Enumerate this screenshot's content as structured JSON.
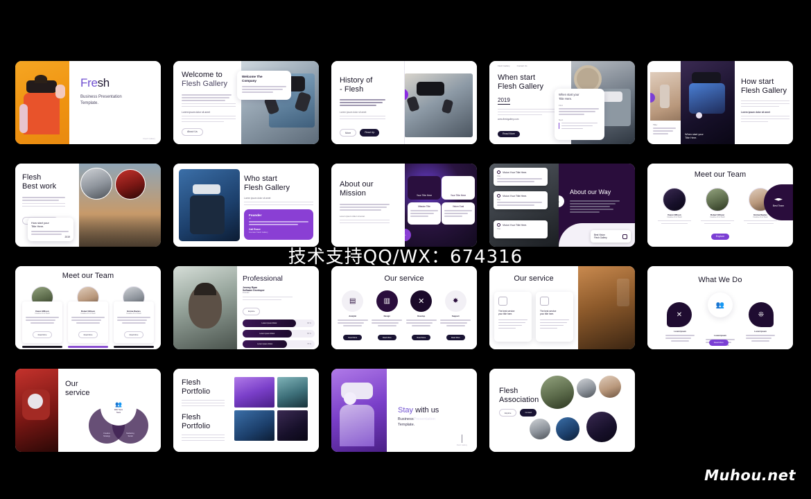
{
  "page": {
    "background": "#000000",
    "accent_purple": "#7b3fd4",
    "accent_deep": "#2a0d3c",
    "slide_bg": "#ffffff"
  },
  "watermarks": {
    "center": "技术支持QQ/WX：674316",
    "corner": "Muhou.net"
  },
  "slides": [
    {
      "id": "cover",
      "title": "Fresh",
      "title_part_1": "Fre",
      "title_part_2": "sh",
      "subtitle_line_1": "Business Presentation",
      "subtitle_line_2": "Template.",
      "image": "woman-orange-vr-headset",
      "footnote": "Flesh Gallery"
    },
    {
      "id": "welcome",
      "title_line_1": "Welcome to",
      "title_line_2": "Flesh Gallery",
      "card_title_line_1": "Welcome The",
      "card_title_line_2": "Company",
      "body": "Lorem ipsum dolor sit amet consectetur. Blandit vitae justo dolor sit amet nulla fringilla.",
      "section_label": "Lorem ipsum dolor sit amet",
      "button": "About Us",
      "image": "woman-vr-controllers"
    },
    {
      "id": "history",
      "title_line_1": "History of",
      "title_line_2": "- Flesh",
      "body": "Lorem ipsum dolor sit amet consectetur adipiscing elit sed do eiusmod tempor incididunt.",
      "section_label": "Lorem ipsum dolor sit amet",
      "button_secondary": "More",
      "button_primary": "Read Up",
      "image": "man-denim-vr-controllers"
    },
    {
      "id": "when-start",
      "nav_left": "Flesh Gallery",
      "nav_right": "Contact Us",
      "title_line_1": "When start",
      "title_line_2": "Flesh Gallery",
      "year": "2019",
      "link": "www.fleshgallery.com",
      "button": "Read More",
      "card_title_line_1": "When start your",
      "card_title_line_2": "Title Here.",
      "card_sub_1": "First",
      "card_sub_2": "Next",
      "image": "boy-vr-headset-clock"
    },
    {
      "id": "how-start",
      "title_line_1": "How start",
      "title_line_2": "Flesh Gallery",
      "section_label": "Lorem ipsum dolor sit amet",
      "overlay_line_1": "When start your",
      "overlay_line_2": "Title Here.",
      "caption_label": "Title :",
      "caption_body": "Lorem ipsum dolor sit amet consectetur adipiscing.",
      "image_left": "vr-room-pink",
      "image_right": "man-vr-blue-light"
    },
    {
      "id": "best-work",
      "title_line_1": "Flesh",
      "title_line_2": "Best work",
      "body": "Lorem ipsum dolor sit amet consectetur blandit.",
      "chip": "The best product you Will",
      "card_title_line_1": "How start your",
      "card_title_line_2": "Title Here.",
      "card_value": "2019",
      "image": "city-skyline-sunset"
    },
    {
      "id": "who-start",
      "title_line_1": "Who start",
      "title_line_2": "Flesh Gallery",
      "section_label": "Lorem ipsum dolor sit amet",
      "card_heading": "Founder",
      "card_sub": "of",
      "card_body": "Lorem ipsum dolor sit amet consectetur adipiscing elit blandit.",
      "card_name": "Call Roser",
      "card_role": "Founder Flesh Gallery",
      "image": "boy-vr-headset-screen"
    },
    {
      "id": "about-mission",
      "title_line_1": "About our",
      "title_line_2": "Mission",
      "body": "Lorem ipsum dolor sit amet consectetur adipiscing elit sed do eiusmod tempor.",
      "section_label": "Lorem ipsum dolor sit amet",
      "card_1_title": "Your Title Here",
      "card_2_title": "Your Title Here",
      "card_3_title": "Mission Title",
      "card_4_title": "Vision Goal",
      "image": "abstract-neon-keyboard"
    },
    {
      "id": "about-our-way",
      "title": "About our Way",
      "list_item_1": "Vision Your Title Here.",
      "list_item_2": "Vision Your Title Here.",
      "list_item_3": "Vision Your Title Here.",
      "list_sub": "Title :",
      "badge_line_1": "Best Vision",
      "badge_line_2": "Flesh Gallery",
      "image": "city-buildings-dark"
    },
    {
      "id": "meet-team-1",
      "title": "Meet our Team",
      "members": [
        {
          "name": "Karen Wilson",
          "role": "Creative Art of Flesh"
        },
        {
          "name": "Robert Ellison",
          "role": "Creative Art of Flesh"
        },
        {
          "name": "Emma Davies",
          "role": "Creative Art of Flesh"
        }
      ],
      "button": "Explore",
      "badge": "Best Team"
    },
    {
      "id": "meet-team-2",
      "title": "Meet our Team",
      "members": [
        {
          "name": "Karen Wilson",
          "role": "Creative Art of Flesh",
          "button": "Read More"
        },
        {
          "name": "Robert Ellison",
          "role": "Creative Art of Flesh",
          "button": "Read More"
        },
        {
          "name": "Emma Davies",
          "role": "Creative Art of Flesh",
          "button": "Read More"
        }
      ]
    },
    {
      "id": "professional",
      "title": "Professional",
      "name": "Jeremy Ryan",
      "role": "Software Developer",
      "meta": "Founder",
      "button": "Explore",
      "rows": [
        {
          "label": "Lorem Ipsum Dolor",
          "value": "90 %"
        },
        {
          "label": "Lorem Ipsum Dolor",
          "value": "80 %"
        },
        {
          "label": "Lorem Ipsum Dolor",
          "value": "75 %"
        }
      ],
      "image": "man-face-scan"
    },
    {
      "id": "our-service-icons",
      "title": "Our service",
      "items": [
        {
          "label": "Analytic",
          "button": "Read More",
          "icon": "chart-icon"
        },
        {
          "label": "Design",
          "button": "Read More",
          "icon": "image-icon"
        },
        {
          "label": "Develop",
          "button": "Read More",
          "icon": "rocket-icon"
        },
        {
          "label": "Support",
          "button": "Read More",
          "icon": "bulb-icon"
        }
      ]
    },
    {
      "id": "our-service-cards",
      "title": "Our service",
      "card_1_title_line_1": "The best service",
      "card_1_title_line_2": "your title here.",
      "card_2_title_line_1": "The best service",
      "card_2_title_line_2": "your title here.",
      "image": "cafe-interior"
    },
    {
      "id": "what-we-do",
      "title": "What We Do",
      "items": [
        {
          "label": "Lorem Ipsum",
          "icon": "rocket-icon"
        },
        {
          "label": "Lorem Ipsum",
          "icon": "team-icon"
        },
        {
          "label": "Lorem Ipsum",
          "icon": "network-icon"
        }
      ],
      "button": "Read More"
    },
    {
      "id": "our-service-venn",
      "title_line_1": "Our",
      "title_line_2": "service",
      "venn_top_line_1": "Web Team",
      "venn_top_line_2": "Team",
      "venn_left_line_1": "Creative",
      "venn_left_line_2": "Strategy",
      "venn_right_line_1": "Marketing",
      "venn_right_line_2": "Social",
      "image": "woman-red-vr"
    },
    {
      "id": "portfolio",
      "block_1_title_line_1": "Flesh",
      "block_1_title_line_2": "Portfolio",
      "block_2_title_line_1": "Flesh",
      "block_2_title_line_2": "Portfolio",
      "images": [
        "gamer-headset",
        "office-meeting",
        "woman-vr-headset",
        "two-women-vr"
      ]
    },
    {
      "id": "stay-with-us",
      "title_strong": "Stay",
      "title_rest": " with us",
      "sub_line_1": "Business",
      "sub_ghost": "Presentation",
      "sub_line_2": "Template.",
      "footnote": "Flesh Gallery",
      "image": "woman-purple-vr"
    },
    {
      "id": "flesh-association",
      "title_line_1": "Flesh",
      "title_line_2": "Association",
      "button_secondary": "Explore",
      "button_primary": "Contact",
      "images": [
        "group-outdoor",
        "people-1",
        "people-2",
        "people-3",
        "people-4",
        "people-5"
      ]
    }
  ]
}
